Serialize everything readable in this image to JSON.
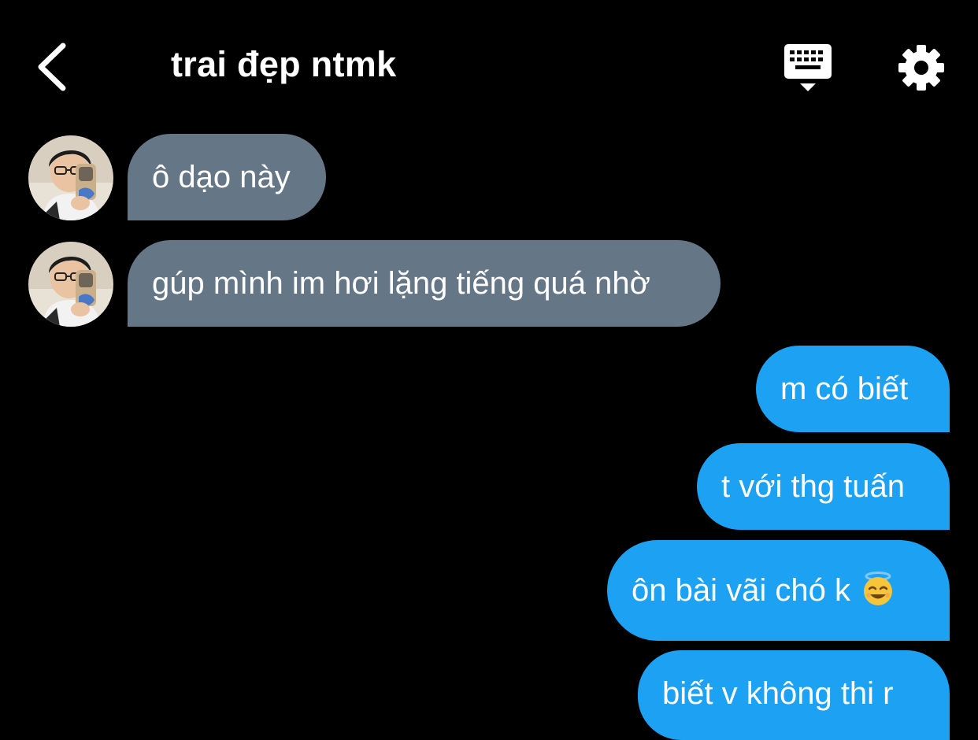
{
  "header": {
    "title": "trai đẹp ntmk",
    "back_icon": "chevron-left-icon",
    "keyboard_icon": "keyboard-icon",
    "settings_icon": "gear-icon"
  },
  "colors": {
    "background": "#000000",
    "incoming_bubble": "#657786",
    "outgoing_bubble": "#1da1f2",
    "text": "#ffffff"
  },
  "messages": [
    {
      "direction": "incoming",
      "text": "ô dạo này",
      "avatar": "contact-avatar"
    },
    {
      "direction": "incoming",
      "text": "gúp mình im hơi lặng tiếng quá nhờ",
      "avatar": "contact-avatar"
    },
    {
      "direction": "outgoing",
      "text": "m có biết"
    },
    {
      "direction": "outgoing",
      "text": "t với thg tuấn"
    },
    {
      "direction": "outgoing",
      "text": "ôn bài vãi chó k",
      "emoji": "smiling-face-with-halo"
    },
    {
      "direction": "outgoing",
      "text": "biết v không thi r"
    }
  ]
}
